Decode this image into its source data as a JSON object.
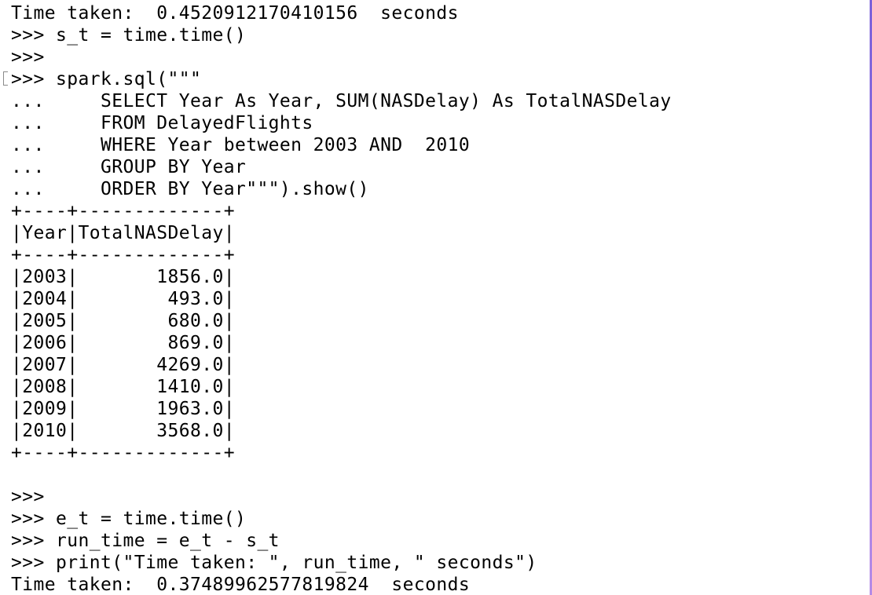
{
  "terminal": {
    "lines": [
      "Time taken:  0.4520912170410156  seconds",
      ">>> s_t = time.time()",
      ">>>",
      ">>> spark.sql(\"\"\"",
      "...     SELECT Year As Year, SUM(NASDelay) As TotalNASDelay",
      "...     FROM DelayedFlights",
      "...     WHERE Year between 2003 AND  2010",
      "...     GROUP BY Year",
      "...     ORDER BY Year\"\"\").show()",
      "+----+-------------+",
      "|Year|TotalNASDelay|",
      "+----+-------------+",
      "|2003|       1856.0|",
      "|2004|        493.0|",
      "|2005|        680.0|",
      "|2006|        869.0|",
      "|2007|       4269.0|",
      "|2008|       1410.0|",
      "|2009|       1963.0|",
      "|2010|       3568.0|",
      "+----+-------------+",
      "",
      ">>>",
      ">>> e_t = time.time()",
      ">>> run_time = e_t - s_t",
      ">>> print(\"Time taken: \", run_time, \" seconds\")",
      "Time taken:  0.37489962577819824  seconds"
    ]
  },
  "result_table": {
    "columns": [
      "Year",
      "TotalNASDelay"
    ],
    "rows": [
      [
        "2003",
        "1856.0"
      ],
      [
        "2004",
        "493.0"
      ],
      [
        "2005",
        "680.0"
      ],
      [
        "2006",
        "869.0"
      ],
      [
        "2007",
        "4269.0"
      ],
      [
        "2008",
        "1410.0"
      ],
      [
        "2009",
        "1963.0"
      ],
      [
        "2010",
        "3568.0"
      ]
    ]
  },
  "colors": {
    "background": "#ffffff",
    "text": "#000000",
    "scrollbar_accent": "#7b61d9"
  }
}
